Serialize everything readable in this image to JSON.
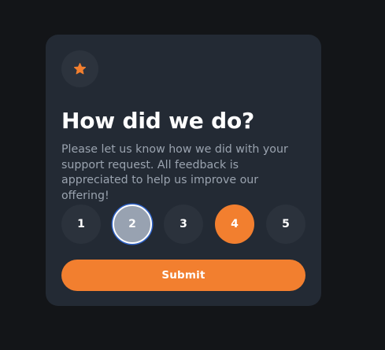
{
  "card": {
    "icon": "star-icon",
    "title": "How did we do?",
    "description": "Please let us know how we did with your support request. All feedback is appreciated to help us improve our offering!",
    "ratings": [
      "1",
      "2",
      "3",
      "4",
      "5"
    ],
    "focused_rating": "2",
    "selected_rating": "4",
    "submit_label": "Submit"
  },
  "colors": {
    "background": "#131518",
    "card": "#232a34",
    "accent": "#f27f2f",
    "rating_idle": "#2b323c",
    "rating_focused": "#98a2b1",
    "focus_ring": "#2f63c8",
    "body_text": "#9aa3af",
    "heading_text": "#ffffff"
  }
}
